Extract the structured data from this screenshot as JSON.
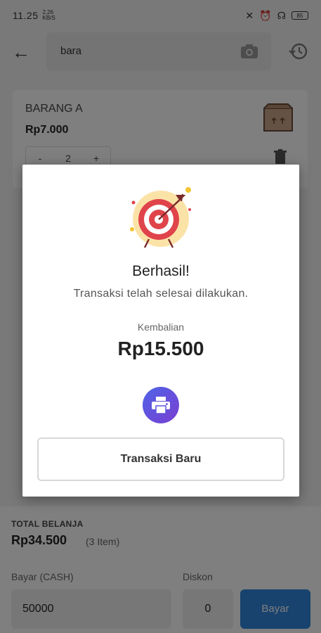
{
  "status_bar": {
    "time": "11.25",
    "network_top": "2,26",
    "network_bottom": "KB/S",
    "battery": "85"
  },
  "header": {
    "search_value": "bara"
  },
  "item": {
    "name": "BARANG A",
    "price": "Rp7.000",
    "qty_minus": "-",
    "qty_value": "2",
    "qty_plus": "+"
  },
  "summary": {
    "total_label": "TOTAL BELANJA",
    "total_value": "Rp34.500",
    "item_count": "(3 Item)",
    "pay_label": "Bayar (CASH)",
    "pay_value": "50000",
    "discount_label": "Diskon",
    "discount_value": "0",
    "pay_button": "Bayar"
  },
  "dialog": {
    "title": "Berhasil!",
    "message": "Transaksi telah selesai dilakukan.",
    "change_label": "Kembalian",
    "change_value": "Rp15.500",
    "new_transaction_button": "Transaksi Baru"
  },
  "colors": {
    "primary": "#2f86dd",
    "print_button": "#5a55e0",
    "target_red": "#e0444b"
  },
  "icons": [
    "back-arrow-icon",
    "camera-icon",
    "history-icon",
    "box-icon",
    "trash-icon",
    "print-icon",
    "target-icon"
  ]
}
